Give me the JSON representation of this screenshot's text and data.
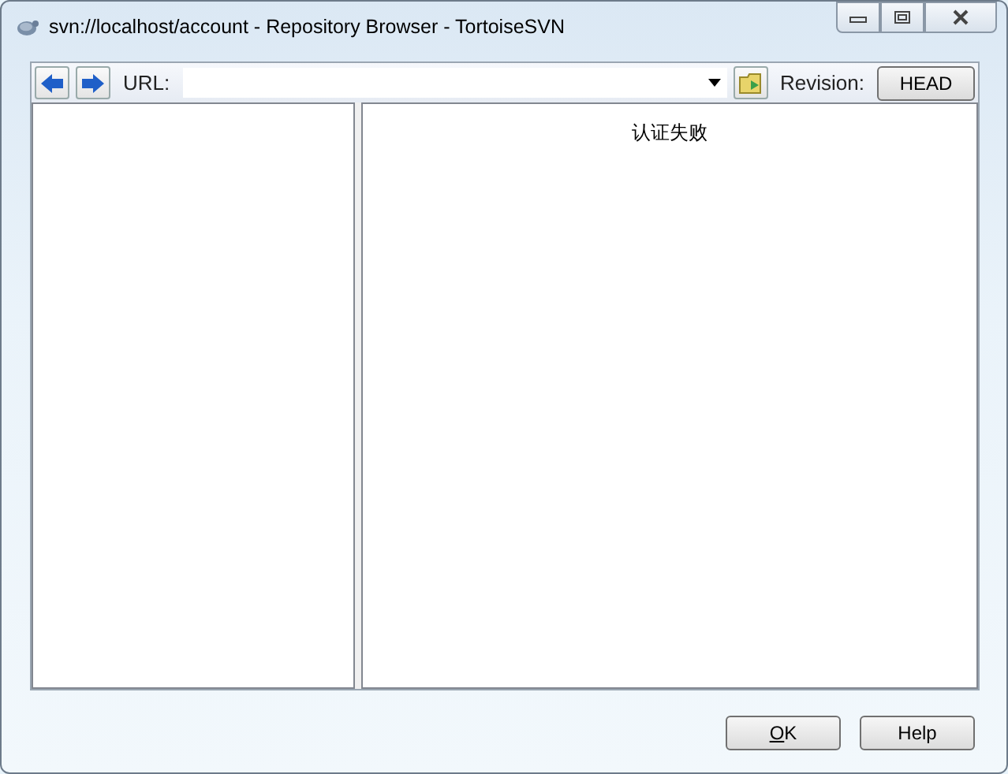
{
  "window": {
    "title": "svn://localhost/account - Repository Browser - TortoiseSVN"
  },
  "toolbar": {
    "url_label": "URL:",
    "revision_label": "Revision:",
    "revision_button": "HEAD"
  },
  "content": {
    "message": "认证失败"
  },
  "buttons": [
    {
      "label": "OK",
      "kind": "ok"
    },
    {
      "label": "Help",
      "kind": "help"
    }
  ]
}
